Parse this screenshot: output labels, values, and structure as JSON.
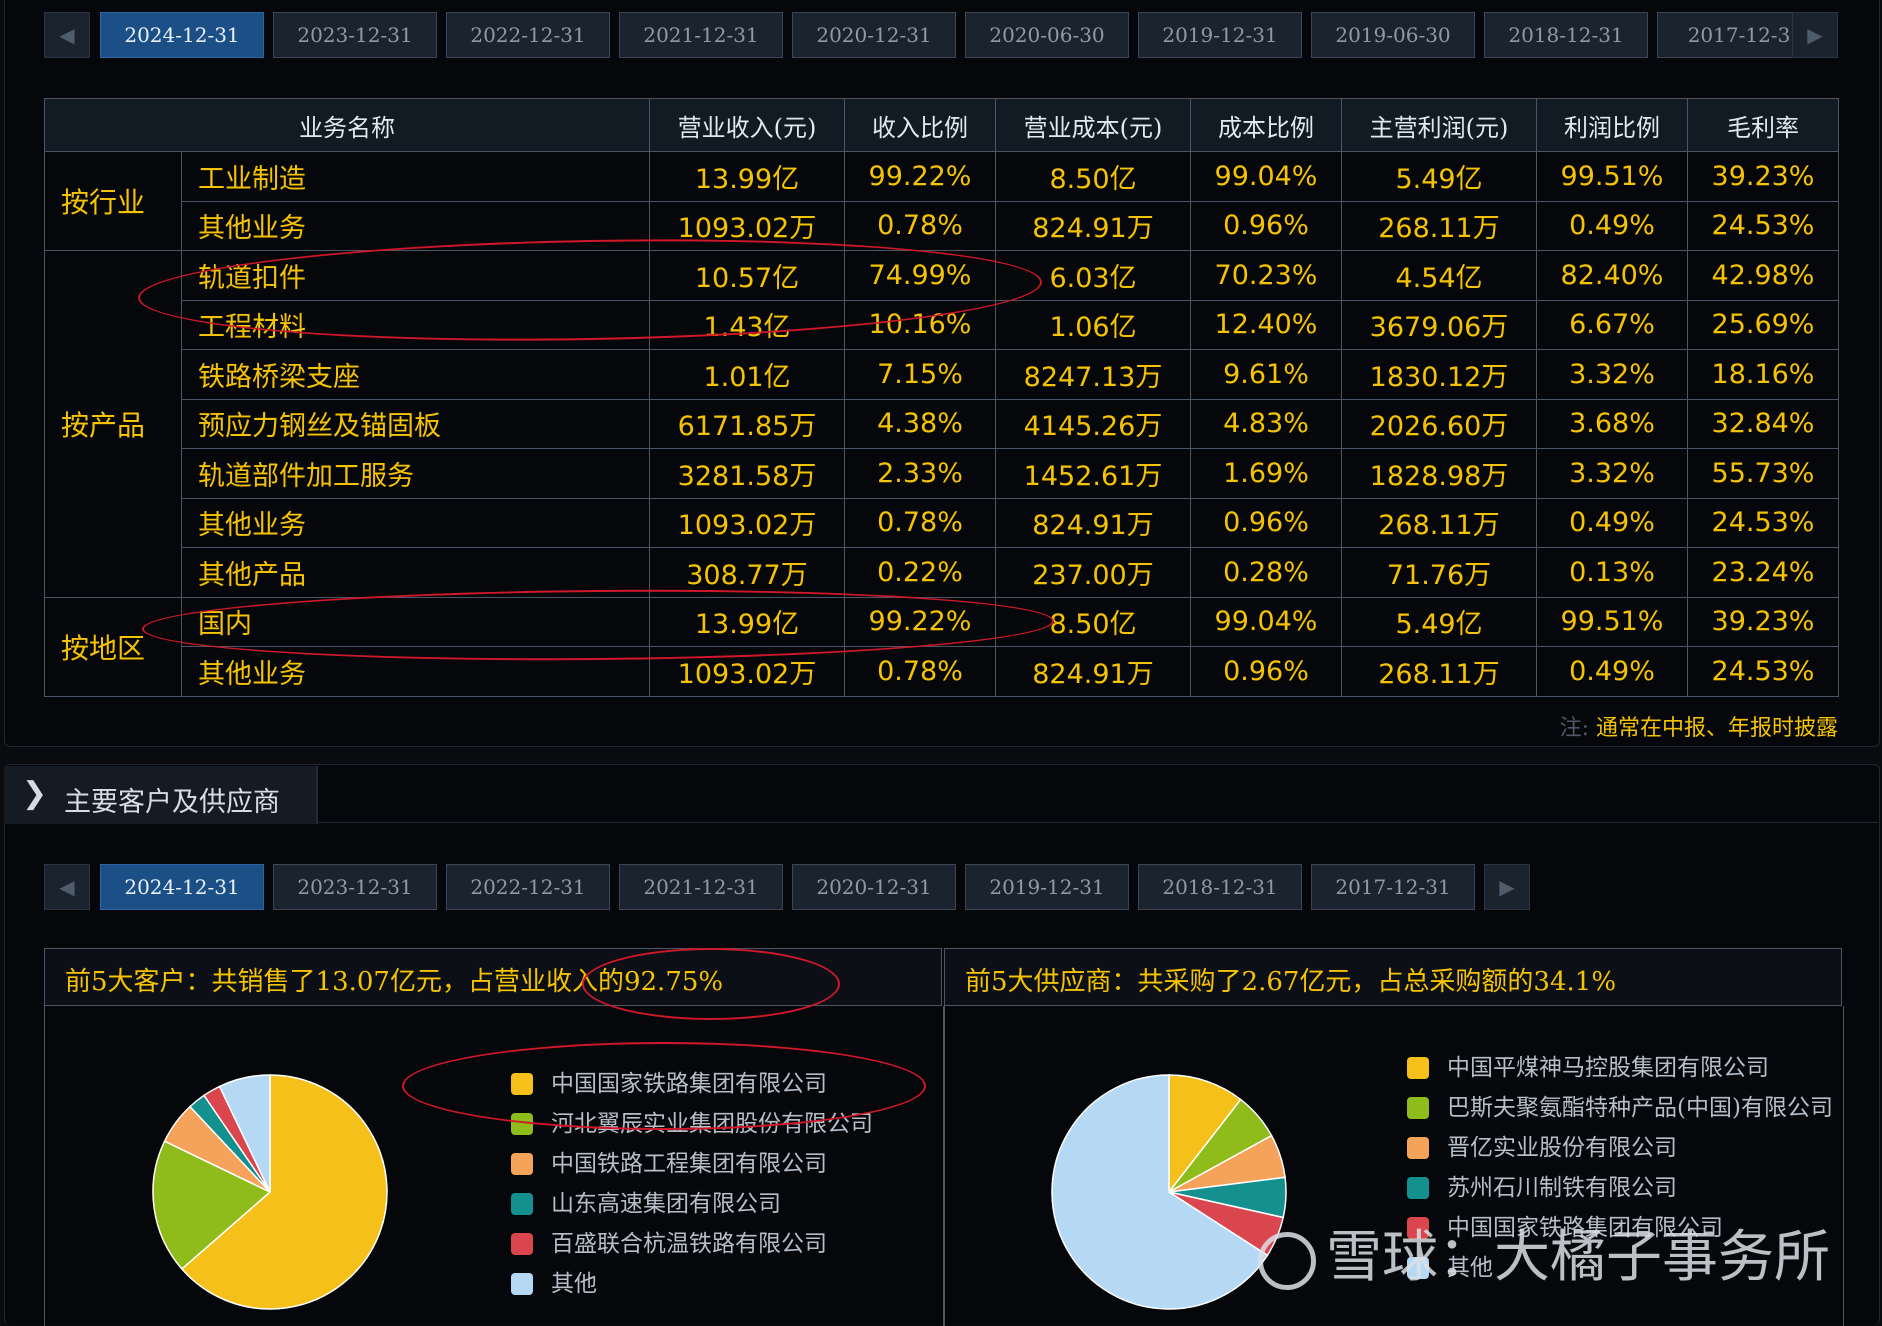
{
  "top_tabs": [
    "2024-12-31",
    "2023-12-31",
    "2022-12-31",
    "2021-12-31",
    "2020-12-31",
    "2020-06-30",
    "2019-12-31",
    "2019-06-30",
    "2018-12-31",
    "2017-12-3"
  ],
  "table": {
    "headers": [
      "业务名称",
      "营业收入(元)",
      "收入比例",
      "营业成本(元)",
      "成本比例",
      "主营利润(元)",
      "利润比例",
      "毛利率"
    ],
    "groups": [
      {
        "category": "按行业",
        "rows": [
          [
            "工业制造",
            "13.99亿",
            "99.22%",
            "8.50亿",
            "99.04%",
            "5.49亿",
            "99.51%",
            "39.23%"
          ],
          [
            "其他业务",
            "1093.02万",
            "0.78%",
            "824.91万",
            "0.96%",
            "268.11万",
            "0.49%",
            "24.53%"
          ]
        ]
      },
      {
        "category": "按产品",
        "rows": [
          [
            "轨道扣件",
            "10.57亿",
            "74.99%",
            "6.03亿",
            "70.23%",
            "4.54亿",
            "82.40%",
            "42.98%"
          ],
          [
            "工程材料",
            "1.43亿",
            "10.16%",
            "1.06亿",
            "12.40%",
            "3679.06万",
            "6.67%",
            "25.69%"
          ],
          [
            "铁路桥梁支座",
            "1.01亿",
            "7.15%",
            "8247.13万",
            "9.61%",
            "1830.12万",
            "3.32%",
            "18.16%"
          ],
          [
            "预应力钢丝及锚固板",
            "6171.85万",
            "4.38%",
            "4145.26万",
            "4.83%",
            "2026.60万",
            "3.68%",
            "32.84%"
          ],
          [
            "轨道部件加工服务",
            "3281.58万",
            "2.33%",
            "1452.61万",
            "1.69%",
            "1828.98万",
            "3.32%",
            "55.73%"
          ],
          [
            "其他业务",
            "1093.02万",
            "0.78%",
            "824.91万",
            "0.96%",
            "268.11万",
            "0.49%",
            "24.53%"
          ],
          [
            "其他产品",
            "308.77万",
            "0.22%",
            "237.00万",
            "0.28%",
            "71.76万",
            "0.13%",
            "23.24%"
          ]
        ]
      },
      {
        "category": "按地区",
        "rows": [
          [
            "国内",
            "13.99亿",
            "99.22%",
            "8.50亿",
            "99.04%",
            "5.49亿",
            "99.51%",
            "39.23%"
          ],
          [
            "其他业务",
            "1093.02万",
            "0.78%",
            "824.91万",
            "0.96%",
            "268.11万",
            "0.49%",
            "24.53%"
          ]
        ]
      }
    ]
  },
  "note": {
    "prefix": "注:",
    "text": "通常在中报、年报时披露"
  },
  "section": {
    "title": "主要客户及供应商"
  },
  "bottom_tabs": [
    "2024-12-31",
    "2023-12-31",
    "2022-12-31",
    "2021-12-31",
    "2020-12-31",
    "2019-12-31",
    "2018-12-31",
    "2017-12-31"
  ],
  "customers": {
    "summary": "前5大客户：共销售了13.07亿元，占营业收入的92.75%",
    "legend": [
      {
        "name": "中国国家铁路集团有限公司",
        "color": "#f5c01a"
      },
      {
        "name": "河北翼辰实业集团股份有限公司",
        "color": "#8fbc1a"
      },
      {
        "name": "中国铁路工程集团有限公司",
        "color": "#f5a25a"
      },
      {
        "name": "山东高速集团有限公司",
        "color": "#14918f"
      },
      {
        "name": "百盛联合杭温铁路有限公司",
        "color": "#d9464d"
      },
      {
        "name": "其他",
        "color": "#b5d8f5"
      }
    ]
  },
  "suppliers": {
    "summary": "前5大供应商：共采购了2.67亿元，占总采购额的34.1%",
    "legend": [
      {
        "name": "中国平煤神马控股集团有限公司",
        "color": "#f5c01a"
      },
      {
        "name": "巴斯夫聚氨酯特种产品(中国)有限公司",
        "color": "#8fbc1a"
      },
      {
        "name": "晋亿实业股份有限公司",
        "color": "#f5a25a"
      },
      {
        "name": "苏州石川制铁有限公司",
        "color": "#14918f"
      },
      {
        "name": "中国国家铁路集团有限公司",
        "color": "#d9464d"
      },
      {
        "name": "其他",
        "color": "#b5d8f5"
      }
    ]
  },
  "chart_data": [
    {
      "type": "pie",
      "labels": [
        "中国国家铁路集团有限公司",
        "河北翼辰实业集团股份有限公司",
        "中国铁路工程集团有限公司",
        "山东高速集团有限公司",
        "百盛联合杭温铁路有限公司",
        "其他"
      ],
      "values": [
        65,
        19,
        6,
        2.5,
        2.5,
        7.25
      ],
      "colors": [
        "#f5c01a",
        "#8fbc1a",
        "#f5a25a",
        "#14918f",
        "#d9464d",
        "#b5d8f5"
      ]
    },
    {
      "type": "pie",
      "labels": [
        "中国平煤神马控股集团有限公司",
        "巴斯夫聚氨酯特种产品(中国)有限公司",
        "晋亿实业股份有限公司",
        "苏州石川制铁有限公司",
        "中国国家铁路集团有限公司",
        "其他"
      ],
      "values": [
        10.5,
        6.5,
        6,
        5.5,
        5.6,
        65.9
      ],
      "colors": [
        "#f5c01a",
        "#8fbc1a",
        "#f5a25a",
        "#14918f",
        "#d9464d",
        "#b5d8f5"
      ]
    }
  ],
  "watermark": {
    "text": "雪球：大橘子事务所"
  }
}
